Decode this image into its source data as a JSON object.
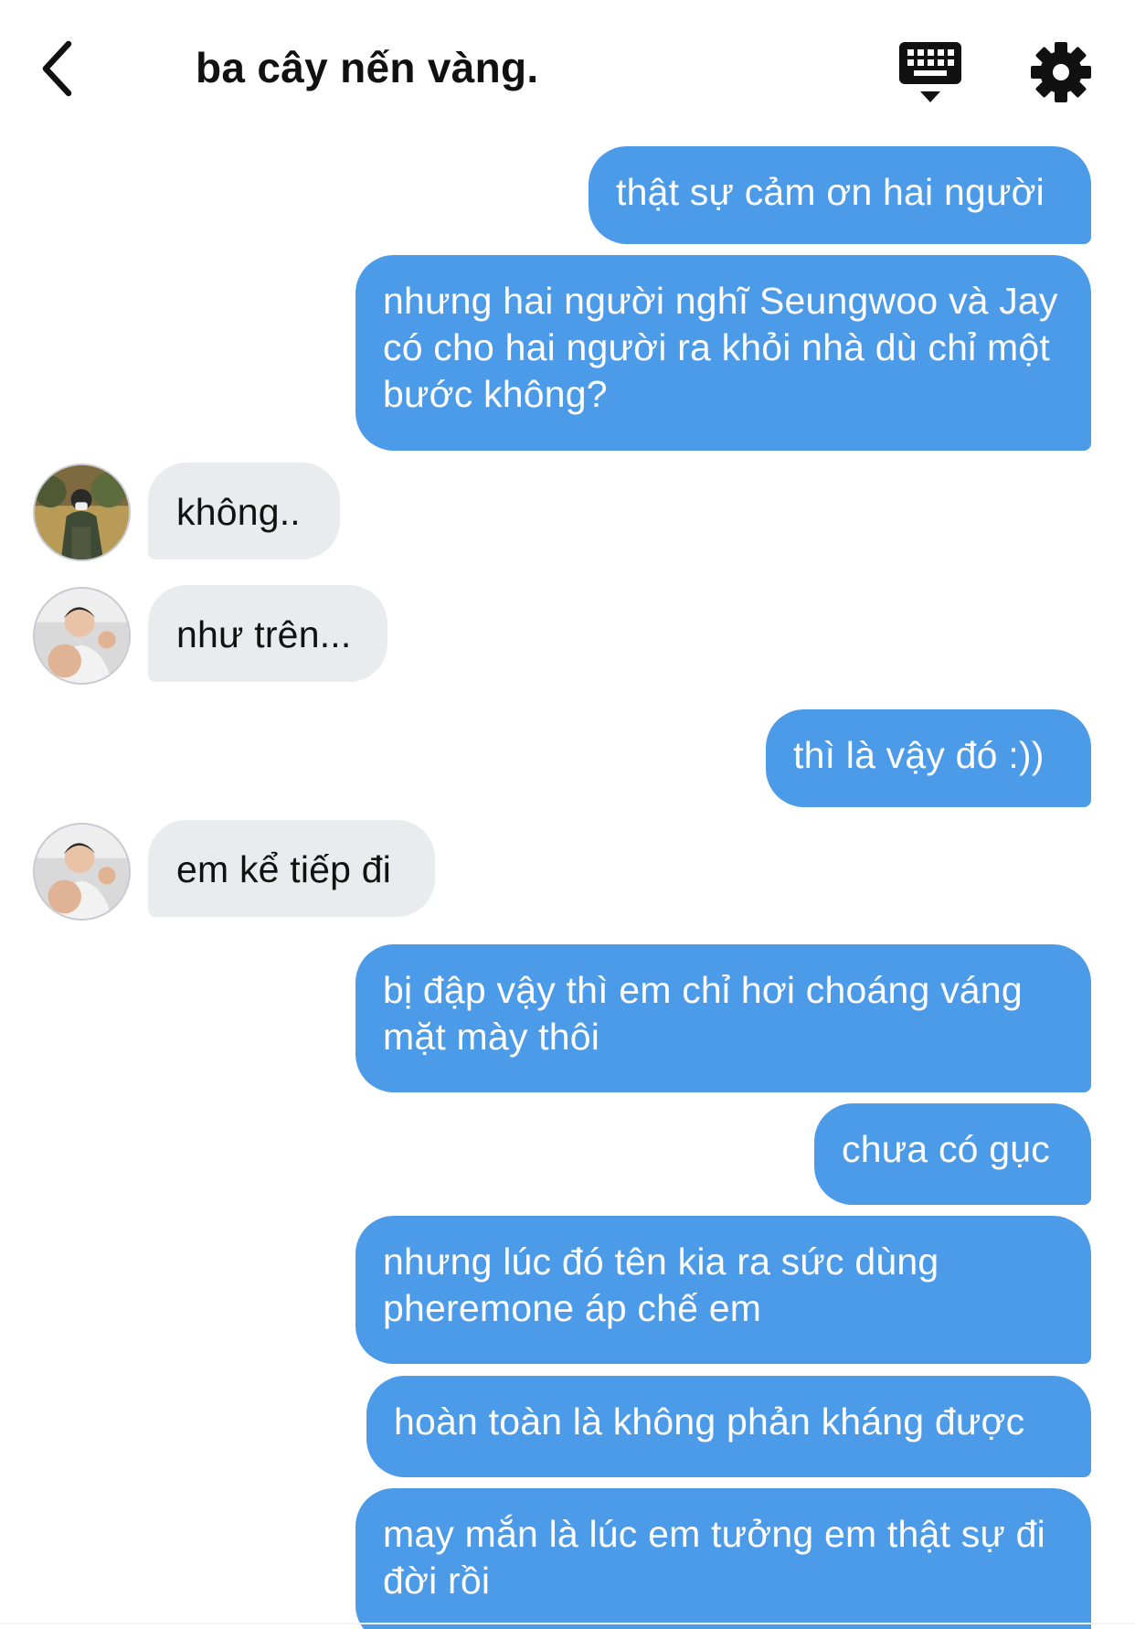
{
  "header": {
    "title": "ba cây nến vàng.",
    "icons": {
      "back": "chevron-left-icon",
      "keyboard": "keyboard-icon",
      "settings": "gear-icon"
    }
  },
  "colors": {
    "outgoing_bubble": "#4c9be8",
    "incoming_bubble": "#e9ebee",
    "title_text": "#111111"
  },
  "messages": [
    {
      "from": "me",
      "text": "thật sự cảm ơn hai người"
    },
    {
      "from": "me",
      "text": "nhưng hai người nghĩ Seungwoo và Jay có cho hai người ra khỏi nhà dù chỉ một bước không?"
    },
    {
      "from": "contact",
      "avatar": "avatar-1",
      "text": "không.."
    },
    {
      "from": "contact",
      "avatar": "avatar-2",
      "text": "như trên..."
    },
    {
      "from": "me",
      "text": "thì là vậy đó :))"
    },
    {
      "from": "contact",
      "avatar": "avatar-2",
      "text": "em kể tiếp đi"
    },
    {
      "from": "me",
      "text": "bị đập vậy thì em chỉ hơi choáng váng mặt mày thôi"
    },
    {
      "from": "me",
      "text": "chưa có gục"
    },
    {
      "from": "me",
      "text": "nhưng lúc đó tên kia ra sức dùng pheremone áp chế em"
    },
    {
      "from": "me",
      "text": "hoàn toàn là không phản kháng được"
    },
    {
      "from": "me",
      "text": "may mắn là lúc em tưởng em thật sự đi đời rồi"
    }
  ]
}
